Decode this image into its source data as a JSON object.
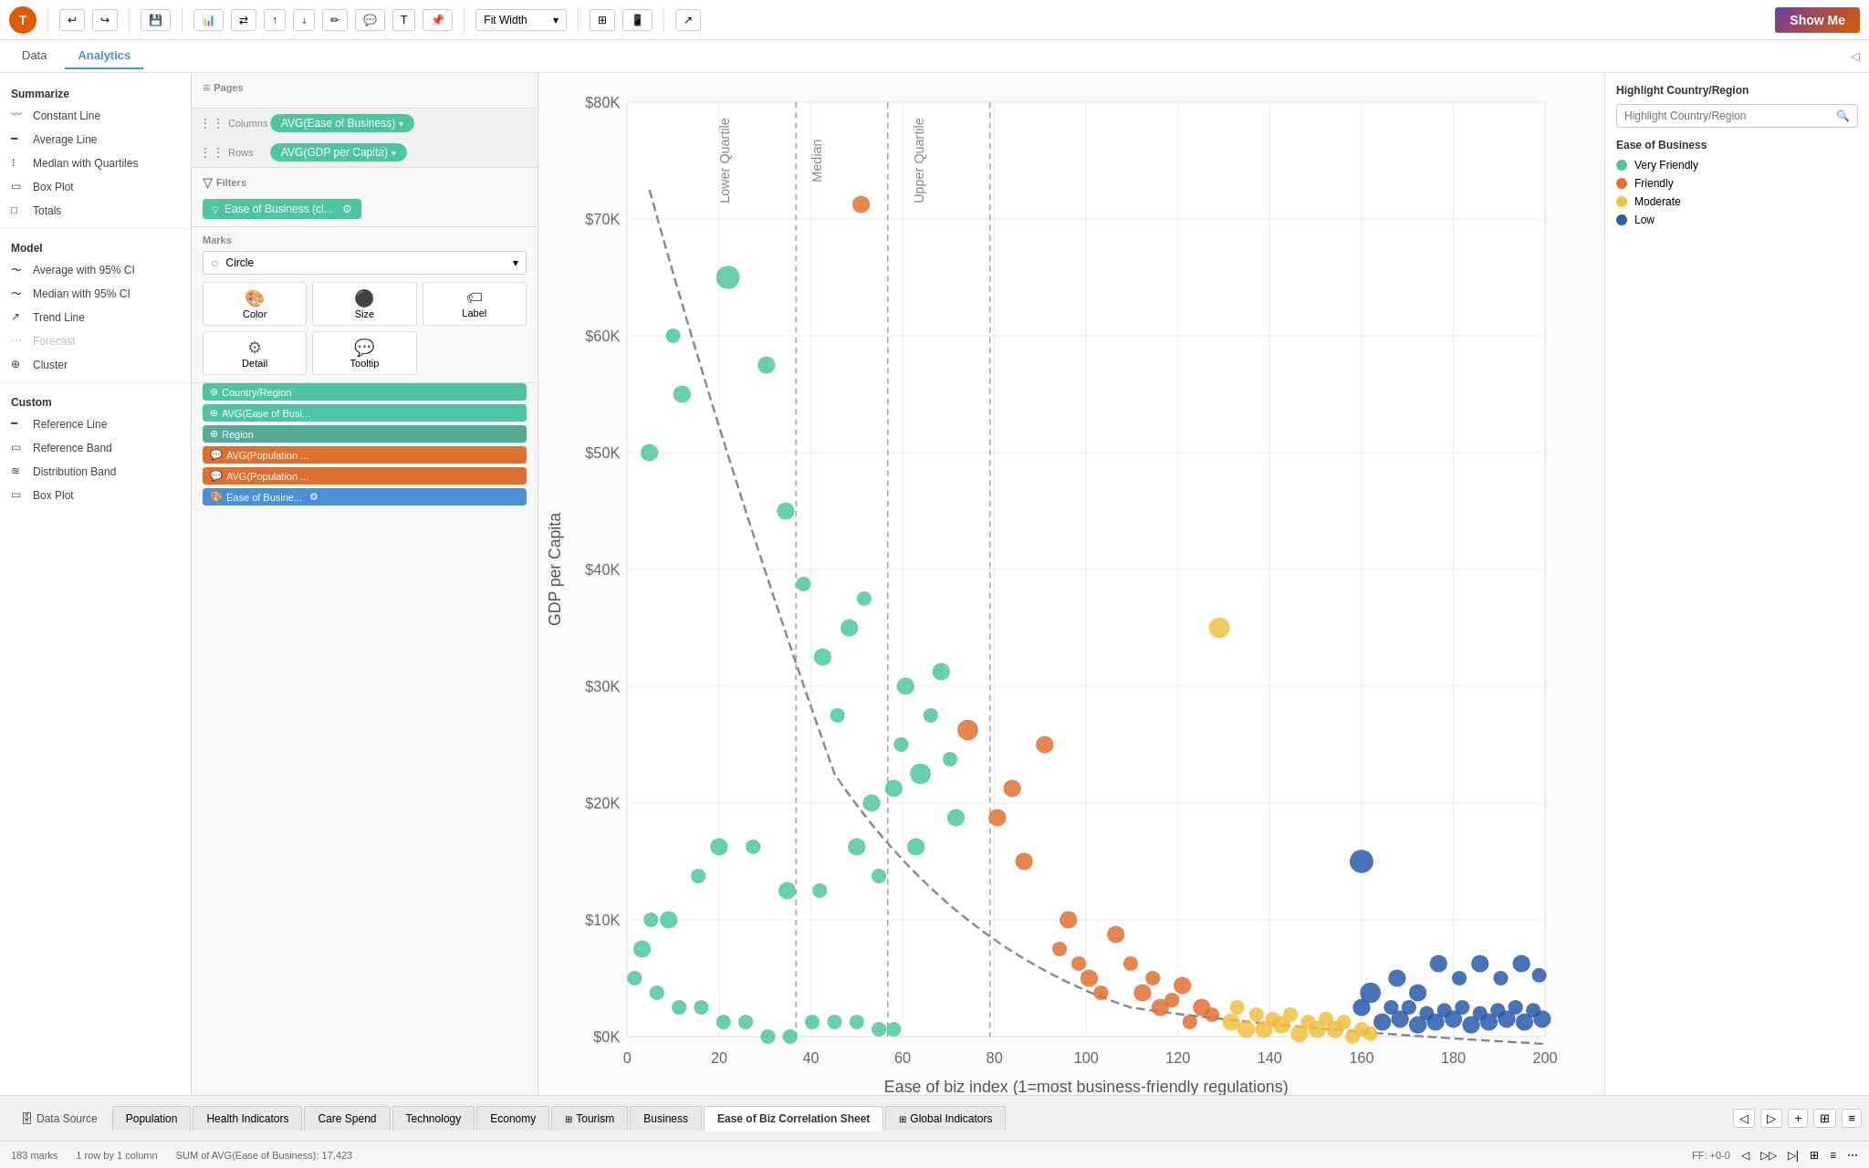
{
  "toolbar": {
    "logo": "T",
    "undo_label": "↩",
    "redo_label": "↪",
    "save_label": "💾",
    "zoom_label": "Fit Width",
    "show_me_label": "Show Me"
  },
  "header_tabs": {
    "data_label": "Data",
    "analytics_label": "Analytics"
  },
  "pills": {
    "columns_label": "Columns",
    "rows_label": "Rows",
    "columns_pill": "AVG(Ease of Business)",
    "rows_pill": "AVG(GDP per Capita)"
  },
  "pages": {
    "title": "Pages"
  },
  "filters": {
    "title": "Filters",
    "chip_label": "Ease of Business (cl..."
  },
  "marks": {
    "title": "Marks",
    "type": "Circle",
    "cells": [
      {
        "label": "Color",
        "icon": "🎨"
      },
      {
        "label": "Size",
        "icon": "⬤"
      },
      {
        "label": "Label",
        "icon": "🏷"
      },
      {
        "label": "Detail",
        "icon": "⚙"
      },
      {
        "label": "Tooltip",
        "icon": "💬"
      }
    ],
    "detail_chips": [
      {
        "label": "Country/Region",
        "type": "multi"
      },
      {
        "label": "AVG(Ease of Busi...",
        "type": "multi"
      },
      {
        "label": "Region",
        "type": "region"
      },
      {
        "label": "AVG(Population ...",
        "type": "orange",
        "icon": "💬"
      },
      {
        "label": "AVG(Population ...",
        "type": "orange",
        "icon": "💬"
      },
      {
        "label": "Ease of Busine...",
        "type": "blue-chip"
      }
    ]
  },
  "left_panel": {
    "summarize_title": "Summarize",
    "summarize_items": [
      "Constant Line",
      "Average Line",
      "Median with Quartiles",
      "Box Plot",
      "Totals"
    ],
    "model_title": "Model",
    "model_items": [
      "Average with 95% CI",
      "Median with 95% CI",
      "Trend Line",
      "Forecast",
      "Cluster"
    ],
    "custom_title": "Custom",
    "custom_items": [
      "Reference Line",
      "Reference Band",
      "Distribution Band",
      "Box Plot"
    ]
  },
  "chart": {
    "x_label": "Ease of biz index (1=most business-friendly regulations)",
    "y_label": "GDP per Capita",
    "x_ticks": [
      "0",
      "20",
      "40",
      "60",
      "80",
      "100",
      "120",
      "140",
      "160",
      "180",
      "200"
    ],
    "y_ticks": [
      "$0K",
      "$10K",
      "$20K",
      "$30K",
      "$40K",
      "$50K",
      "$60K",
      "$70K",
      "$80K"
    ],
    "ref_lines": [
      {
        "label": "Lower Quartile",
        "x_pct": 37
      },
      {
        "label": "Median",
        "x_pct": 57
      },
      {
        "label": "Upper Quartile",
        "x_pct": 79
      }
    ]
  },
  "right_panel": {
    "highlight_title": "Highlight Country/Region",
    "highlight_placeholder": "Highlight Country/Region",
    "ease_title": "Ease of Business",
    "legend": [
      {
        "label": "Very Friendly",
        "color": "#4dc5a0"
      },
      {
        "label": "Friendly",
        "color": "#e07030"
      },
      {
        "label": "Moderate",
        "color": "#f0c040"
      },
      {
        "label": "Low",
        "color": "#2a5aaa"
      }
    ]
  },
  "bottom_tabs": [
    {
      "label": "Data Source",
      "icon": "db",
      "active": false
    },
    {
      "label": "Population",
      "active": false
    },
    {
      "label": "Health Indicators",
      "active": false
    },
    {
      "label": "Care Spend",
      "active": false
    },
    {
      "label": "Technology",
      "active": false
    },
    {
      "label": "Economy",
      "active": false
    },
    {
      "label": "Tourism",
      "icon": "grid",
      "active": false
    },
    {
      "label": "Business",
      "active": false
    },
    {
      "label": "Ease of Biz Correlation Sheet",
      "active": true
    },
    {
      "label": "Global Indicators",
      "icon": "grid",
      "active": false
    }
  ],
  "status_bar": {
    "marks": "183 marks",
    "rows": "1 row by 1 column",
    "sum_label": "SUM of AVG(Ease of Business): 17,423",
    "ff": "FF: +0-0"
  },
  "scatter_points": [
    {
      "x": 48,
      "y": 148,
      "color": "#e07030",
      "size": 8
    },
    {
      "x": 12,
      "y": 480,
      "color": "#4dc5a0",
      "size": 7
    },
    {
      "x": 8,
      "y": 380,
      "color": "#4dc5a0",
      "size": 6
    },
    {
      "x": 15,
      "y": 430,
      "color": "#4dc5a0",
      "size": 7
    },
    {
      "x": 22,
      "y": 500,
      "color": "#4dc5a0",
      "size": 8
    },
    {
      "x": 30,
      "y": 380,
      "color": "#4dc5a0",
      "size": 6
    },
    {
      "x": 35,
      "y": 410,
      "color": "#4dc5a0",
      "size": 7
    },
    {
      "x": 38,
      "y": 450,
      "color": "#4dc5a0",
      "size": 6
    },
    {
      "x": 42,
      "y": 240,
      "color": "#4dc5a0",
      "size": 7
    },
    {
      "x": 40,
      "y": 320,
      "color": "#4dc5a0",
      "size": 6
    },
    {
      "x": 38,
      "y": 540,
      "color": "#4dc5a0",
      "size": 7
    },
    {
      "x": 45,
      "y": 590,
      "color": "#4dc5a0",
      "size": 6
    },
    {
      "x": 50,
      "y": 330,
      "color": "#4dc5a0",
      "size": 7
    },
    {
      "x": 48,
      "y": 430,
      "color": "#4dc5a0",
      "size": 6
    },
    {
      "x": 52,
      "y": 580,
      "color": "#4dc5a0",
      "size": 8
    },
    {
      "x": 55,
      "y": 610,
      "color": "#4dc5a0",
      "size": 6
    },
    {
      "x": 58,
      "y": 580,
      "color": "#4dc5a0",
      "size": 7
    },
    {
      "x": 60,
      "y": 150,
      "color": "#4dc5a0",
      "size": 6
    },
    {
      "x": 62,
      "y": 590,
      "color": "#4dc5a0",
      "size": 7
    },
    {
      "x": 65,
      "y": 640,
      "color": "#4dc5a0",
      "size": 6
    },
    {
      "x": 68,
      "y": 650,
      "color": "#4dc5a0",
      "size": 7
    },
    {
      "x": 70,
      "y": 620,
      "color": "#4dc5a0",
      "size": 6
    },
    {
      "x": 72,
      "y": 660,
      "color": "#4dc5a0",
      "size": 7
    },
    {
      "x": 75,
      "y": 680,
      "color": "#4dc5a0",
      "size": 6
    },
    {
      "x": 25,
      "y": 240,
      "color": "#4dc5a0",
      "size": 9
    },
    {
      "x": 20,
      "y": 560,
      "color": "#4dc5a0",
      "size": 7
    },
    {
      "x": 18,
      "y": 620,
      "color": "#4dc5a0",
      "size": 6
    },
    {
      "x": 28,
      "y": 680,
      "color": "#4dc5a0",
      "size": 7
    },
    {
      "x": 32,
      "y": 700,
      "color": "#4dc5a0",
      "size": 6
    },
    {
      "x": 36,
      "y": 720,
      "color": "#4dc5a0",
      "size": 7
    },
    {
      "x": 44,
      "y": 710,
      "color": "#4dc5a0",
      "size": 6
    },
    {
      "x": 10,
      "y": 710,
      "color": "#4dc5a0",
      "size": 7
    },
    {
      "x": 5,
      "y": 650,
      "color": "#4dc5a0",
      "size": 6
    },
    {
      "x": 8,
      "y": 720,
      "color": "#4dc5a0",
      "size": 6
    },
    {
      "x": 78,
      "y": 440,
      "color": "#e07030",
      "size": 8
    },
    {
      "x": 82,
      "y": 510,
      "color": "#e07030",
      "size": 7
    },
    {
      "x": 75,
      "y": 530,
      "color": "#e07030",
      "size": 6
    },
    {
      "x": 88,
      "y": 610,
      "color": "#e07030",
      "size": 7
    },
    {
      "x": 85,
      "y": 660,
      "color": "#e07030",
      "size": 6
    },
    {
      "x": 92,
      "y": 640,
      "color": "#e07030",
      "size": 7
    },
    {
      "x": 95,
      "y": 670,
      "color": "#e07030",
      "size": 6
    },
    {
      "x": 98,
      "y": 650,
      "color": "#e07030",
      "size": 7
    },
    {
      "x": 100,
      "y": 700,
      "color": "#e07030",
      "size": 6
    },
    {
      "x": 103,
      "y": 680,
      "color": "#e07030",
      "size": 7
    },
    {
      "x": 105,
      "y": 720,
      "color": "#e07030",
      "size": 6
    },
    {
      "x": 80,
      "y": 590,
      "color": "#e07030",
      "size": 7
    },
    {
      "x": 110,
      "y": 720,
      "color": "#e07030",
      "size": 6
    },
    {
      "x": 115,
      "y": 730,
      "color": "#e07030",
      "size": 7
    },
    {
      "x": 118,
      "y": 740,
      "color": "#e07030",
      "size": 6
    },
    {
      "x": 120,
      "y": 690,
      "color": "#e07030",
      "size": 7
    },
    {
      "x": 122,
      "y": 710,
      "color": "#e07030",
      "size": 6
    },
    {
      "x": 125,
      "y": 740,
      "color": "#f0c040",
      "size": 7
    },
    {
      "x": 128,
      "y": 750,
      "color": "#f0c040",
      "size": 6
    },
    {
      "x": 130,
      "y": 720,
      "color": "#f0c040",
      "size": 7
    },
    {
      "x": 132,
      "y": 740,
      "color": "#f0c040",
      "size": 6
    },
    {
      "x": 135,
      "y": 730,
      "color": "#f0c040",
      "size": 7
    },
    {
      "x": 138,
      "y": 750,
      "color": "#f0c040",
      "size": 6
    },
    {
      "x": 140,
      "y": 740,
      "color": "#f0c040",
      "size": 7
    },
    {
      "x": 142,
      "y": 720,
      "color": "#f0c040",
      "size": 6
    },
    {
      "x": 145,
      "y": 760,
      "color": "#f0c040",
      "size": 7
    },
    {
      "x": 148,
      "y": 750,
      "color": "#f0c040",
      "size": 6
    },
    {
      "x": 150,
      "y": 730,
      "color": "#f0c040",
      "size": 7
    },
    {
      "x": 152,
      "y": 760,
      "color": "#f0c040",
      "size": 6
    },
    {
      "x": 155,
      "y": 740,
      "color": "#f0c040",
      "size": 7
    },
    {
      "x": 158,
      "y": 750,
      "color": "#f0c040",
      "size": 6
    },
    {
      "x": 160,
      "y": 740,
      "color": "#2a5aaa",
      "size": 7
    },
    {
      "x": 162,
      "y": 660,
      "color": "#2a5aaa",
      "size": 8
    },
    {
      "x": 165,
      "y": 700,
      "color": "#2a5aaa",
      "size": 6
    },
    {
      "x": 168,
      "y": 720,
      "color": "#2a5aaa",
      "size": 7
    },
    {
      "x": 170,
      "y": 730,
      "color": "#2a5aaa",
      "size": 6
    },
    {
      "x": 172,
      "y": 710,
      "color": "#2a5aaa",
      "size": 7
    },
    {
      "x": 175,
      "y": 720,
      "color": "#2a5aaa",
      "size": 6
    },
    {
      "x": 178,
      "y": 740,
      "color": "#2a5aaa",
      "size": 7
    },
    {
      "x": 180,
      "y": 730,
      "color": "#2a5aaa",
      "size": 6
    },
    {
      "x": 182,
      "y": 750,
      "color": "#2a5aaa",
      "size": 7
    },
    {
      "x": 185,
      "y": 730,
      "color": "#2a5aaa",
      "size": 6
    },
    {
      "x": 188,
      "y": 700,
      "color": "#2a5aaa",
      "size": 7
    },
    {
      "x": 190,
      "y": 720,
      "color": "#2a5aaa",
      "size": 6
    },
    {
      "x": 193,
      "y": 750,
      "color": "#2a5aaa",
      "size": 7
    },
    {
      "x": 196,
      "y": 740,
      "color": "#2a5aaa",
      "size": 6
    },
    {
      "x": 198,
      "y": 730,
      "color": "#2a5aaa",
      "size": 7
    },
    {
      "x": 163,
      "y": 690,
      "color": "#2a5aaa",
      "size": 6
    },
    {
      "x": 166,
      "y": 710,
      "color": "#2a5aaa",
      "size": 7
    },
    {
      "x": 145,
      "y": 630,
      "color": "#2a5aaa",
      "size": 9
    },
    {
      "x": 90,
      "y": 465,
      "color": "#f0c040",
      "size": 7
    }
  ]
}
